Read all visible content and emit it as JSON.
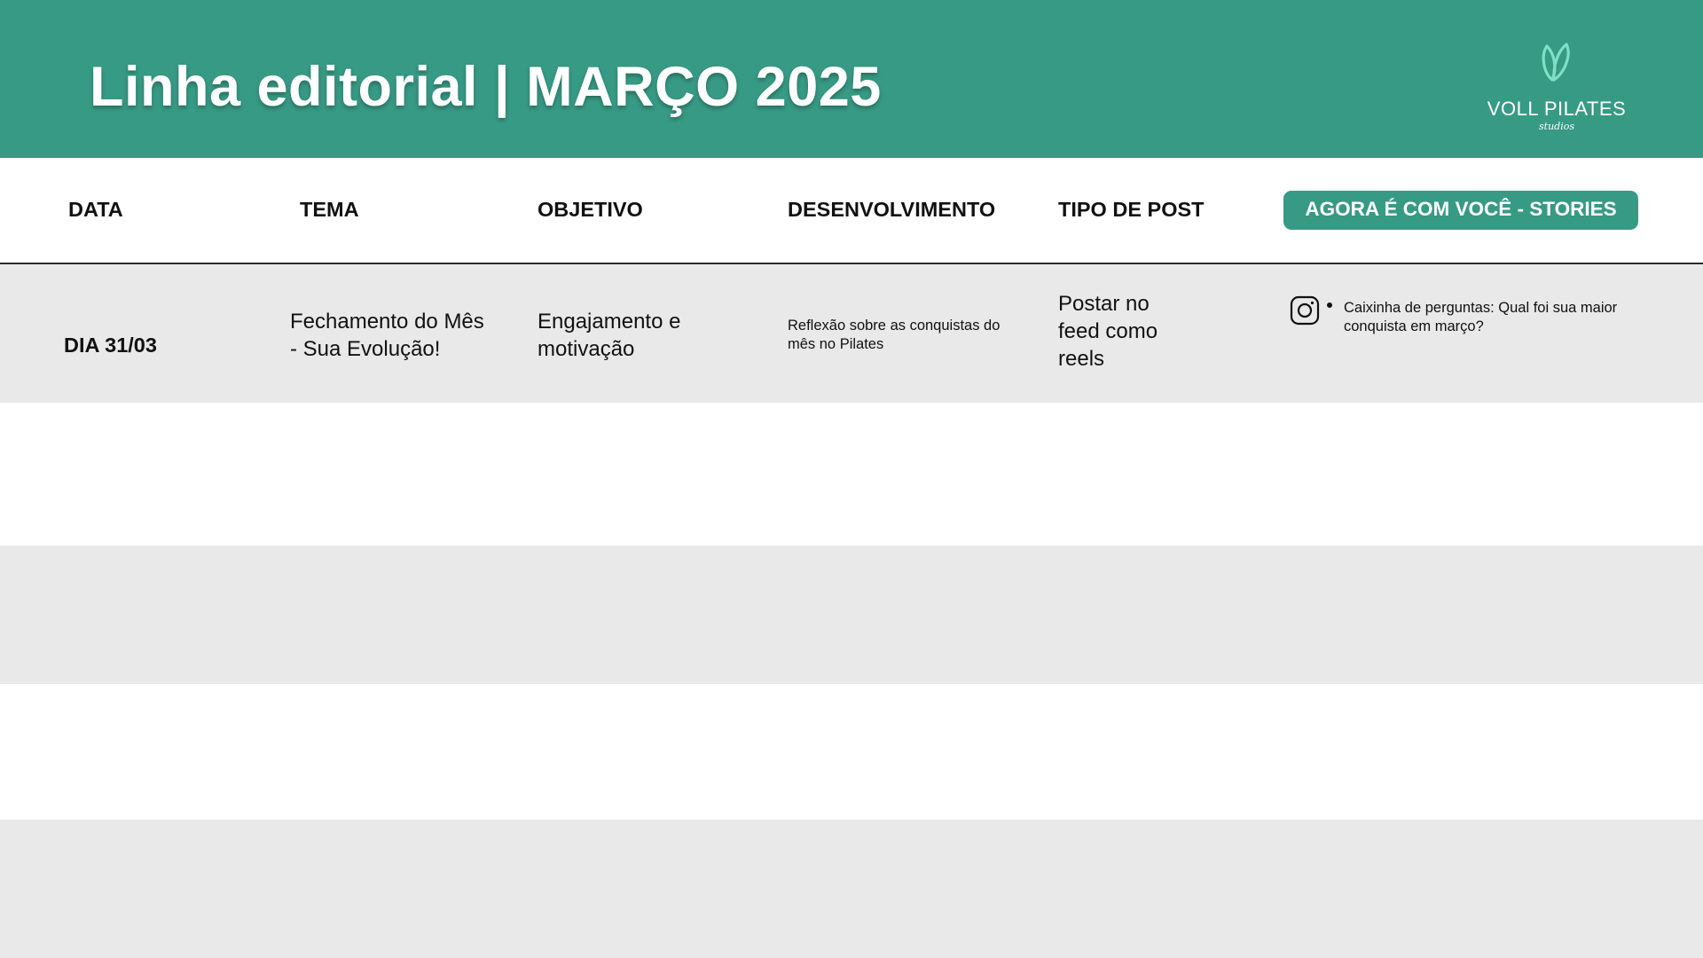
{
  "header": {
    "title": "Linha editorial | MARÇO 2025",
    "background_color": "#379a84",
    "logo": {
      "brand": "VOLL PILATES",
      "sub": "studios",
      "icon": "leaf-v-icon"
    }
  },
  "table": {
    "columns": {
      "data": "DATA",
      "tema": "TEMA",
      "objetivo": "OBJETIVO",
      "desenvolvimento": "DESENVOLVIMENTO",
      "tipo_de_post": "TIPO DE POST",
      "stories": "AGORA É COM VOCÊ - STORIES"
    },
    "rows": [
      {
        "data": "DIA 31/03",
        "tema": [
          "Fechamento do Mês",
          "- Sua Evolução!"
        ],
        "objetivo": [
          "Engajamento e",
          "motivação"
        ],
        "desenvolvimento": [
          "Reflexão sobre as conquistas do",
          "mês no Pilates"
        ],
        "tipo_de_post": [
          "Postar no",
          "feed como",
          "reels"
        ],
        "stories": {
          "icon": "instagram-icon",
          "bullet": [
            "Caixinha de perguntas: Qual foi sua maior",
            "conquista em março?"
          ]
        }
      }
    ]
  },
  "colors": {
    "accent": "#379a84",
    "row_band": "#e9e9e9",
    "text": "#111111"
  }
}
